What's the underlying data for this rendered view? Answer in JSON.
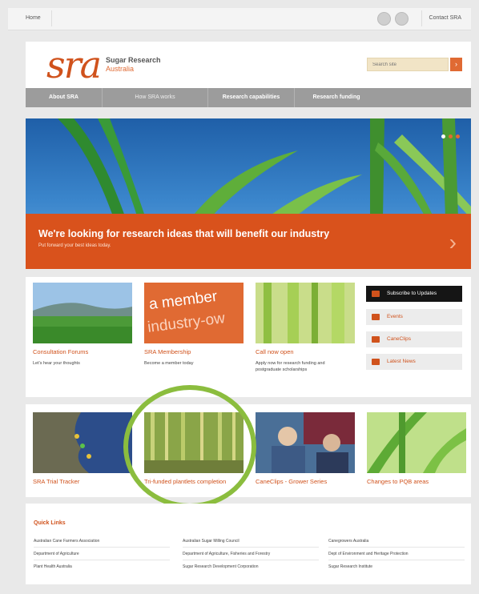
{
  "topbar": {
    "home": "Home",
    "contact": "Contact SRA"
  },
  "header": {
    "logo_mark": "sra",
    "logo_name": "Sugar Research",
    "logo_sub": "Australia",
    "search_placeholder": "Search site",
    "search_button_icon": "arrow-right-icon"
  },
  "nav": {
    "items": [
      "About SRA",
      "How SRA works",
      "Research capabilities",
      "Research funding"
    ]
  },
  "hero": {
    "title": "We're looking for research ideas that will benefit our industry",
    "subtitle": "Put forward your best ideas today.",
    "arrow": "›",
    "slide_count": 3,
    "active_slide": 1
  },
  "row1": {
    "tiles": [
      {
        "title": "Consultation Forums",
        "desc": "Let's hear your thoughts"
      },
      {
        "title": "SRA Membership",
        "desc": "Become a member today",
        "banner_line1": "a member",
        "banner_line2": "industry-ow"
      },
      {
        "title": "Call now open",
        "desc": "Apply now for research funding and postgraduate scholarships"
      }
    ],
    "sidebar": [
      "Subscribe to Updates",
      "Events",
      "CaneClips",
      "Latest News"
    ]
  },
  "row2": {
    "tiles": [
      {
        "title": "SRA Trial Tracker"
      },
      {
        "title": "Tri-funded plantlets completion"
      },
      {
        "title": "CaneClips - Grower Series"
      },
      {
        "title": "Changes to PQB areas"
      }
    ]
  },
  "quick_links": {
    "title": "Quick Links",
    "columns": [
      [
        "Australian Cane Farmers Association",
        "Department of Agriculture",
        "Plant Health Australia"
      ],
      [
        "Australian Sugar Milling Council",
        "Department of Agriculture, Fisheries and Forestry",
        "Sugar Research Development Corporation"
      ],
      [
        "Canegrowers Australia",
        "Dept of Environment and Heritage Protection",
        "Sugar Research Institute"
      ]
    ]
  },
  "colors": {
    "accent": "#d9521c",
    "nav": "#9c9c9c",
    "highlight": "#8bbd3e"
  }
}
